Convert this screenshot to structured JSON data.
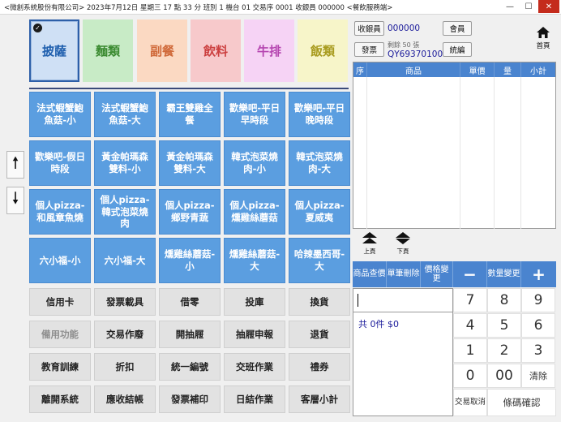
{
  "window": {
    "title": "<微創系統股份有限公司> 2023年7月12日 星期三 17 點 33 分 班別 1 機台 01 交易序 0001 收銀員 000000 <餐飲服務端>",
    "min": "—",
    "max": "☐",
    "close": "✕"
  },
  "categories": [
    {
      "label": "披薩",
      "bg": "#cfe0f5",
      "fg": "#1f5fae"
    },
    {
      "label": "麵類",
      "bg": "#c8ebc6",
      "fg": "#3a8a30"
    },
    {
      "label": "副餐",
      "bg": "#fbd9c2",
      "fg": "#d06a3a"
    },
    {
      "label": "飲料",
      "bg": "#f7c9cb",
      "fg": "#cc4040"
    },
    {
      "label": "牛排",
      "bg": "#f6d3f5",
      "fg": "#b545b0"
    },
    {
      "label": "飯類",
      "bg": "#f7f5c9",
      "fg": "#a89b1e"
    }
  ],
  "selected_check": "✓",
  "products": [
    "法式蝦蟹鮑魚菇-小",
    "法式蝦蟹鮑魚菇-大",
    "霸王雙雞全餐",
    "歡樂吧-平日早時段",
    "歡樂吧-平日晚時段",
    "歡樂吧-假日時段",
    "黃金帕瑪森雙料-小",
    "黃金帕瑪森雙料-大",
    "韓式泡菜燒肉-小",
    "韓式泡菜燒肉-大",
    "個人pizza-和風章魚燒",
    "個人pizza-韓式泡菜燒肉",
    "個人pizza-鄉野青蔬",
    "個人pizza-燻雞絲蘑菇",
    "個人pizza-夏威夷",
    "六小福-小",
    "六小福-大",
    "燻雞絲蘑菇-小",
    "燻雞絲蘑菇-大",
    "哈辣墨西哥-大"
  ],
  "arrows": {
    "up": "🠕",
    "down": "🠗"
  },
  "functions": [
    "信用卡",
    "發票載具",
    "借零",
    "投庫",
    "換貨",
    "備用功能",
    "交易作廢",
    "開抽屜",
    "抽屜申報",
    "退貨",
    "教育訓練",
    "折扣",
    "統一編號",
    "交班作業",
    "禮券",
    "離開系統",
    "應收結帳",
    "發票補印",
    "日結作業",
    "客層小計"
  ],
  "header": {
    "cashier_label": "收銀員",
    "cashier_value": "000000",
    "member_label": "會員",
    "invoice_label": "發票",
    "invoice_remaining": "剩餘 50 張",
    "invoice_number": "QY69370100",
    "tax_label": "統編",
    "home_label": "首頁"
  },
  "order_table": {
    "headers": [
      "序",
      "商品",
      "單價",
      "量",
      "小計"
    ]
  },
  "nav": {
    "prev": "上頁",
    "next": "下頁"
  },
  "actions": {
    "query": "商品查價",
    "delete": "單筆刪除",
    "price_change": "價格變更",
    "minus": "−",
    "qty_change": "數量變更",
    "plus": "+"
  },
  "summary": "共 0件 $0",
  "keypad": {
    "k7": "7",
    "k8": "8",
    "k9": "9",
    "k4": "4",
    "k5": "5",
    "k6": "6",
    "k1": "1",
    "k2": "2",
    "k3": "3",
    "k0": "0",
    "k00": "00",
    "clear": "清除",
    "cancel": "交易取消",
    "confirm": "條碼確認"
  }
}
